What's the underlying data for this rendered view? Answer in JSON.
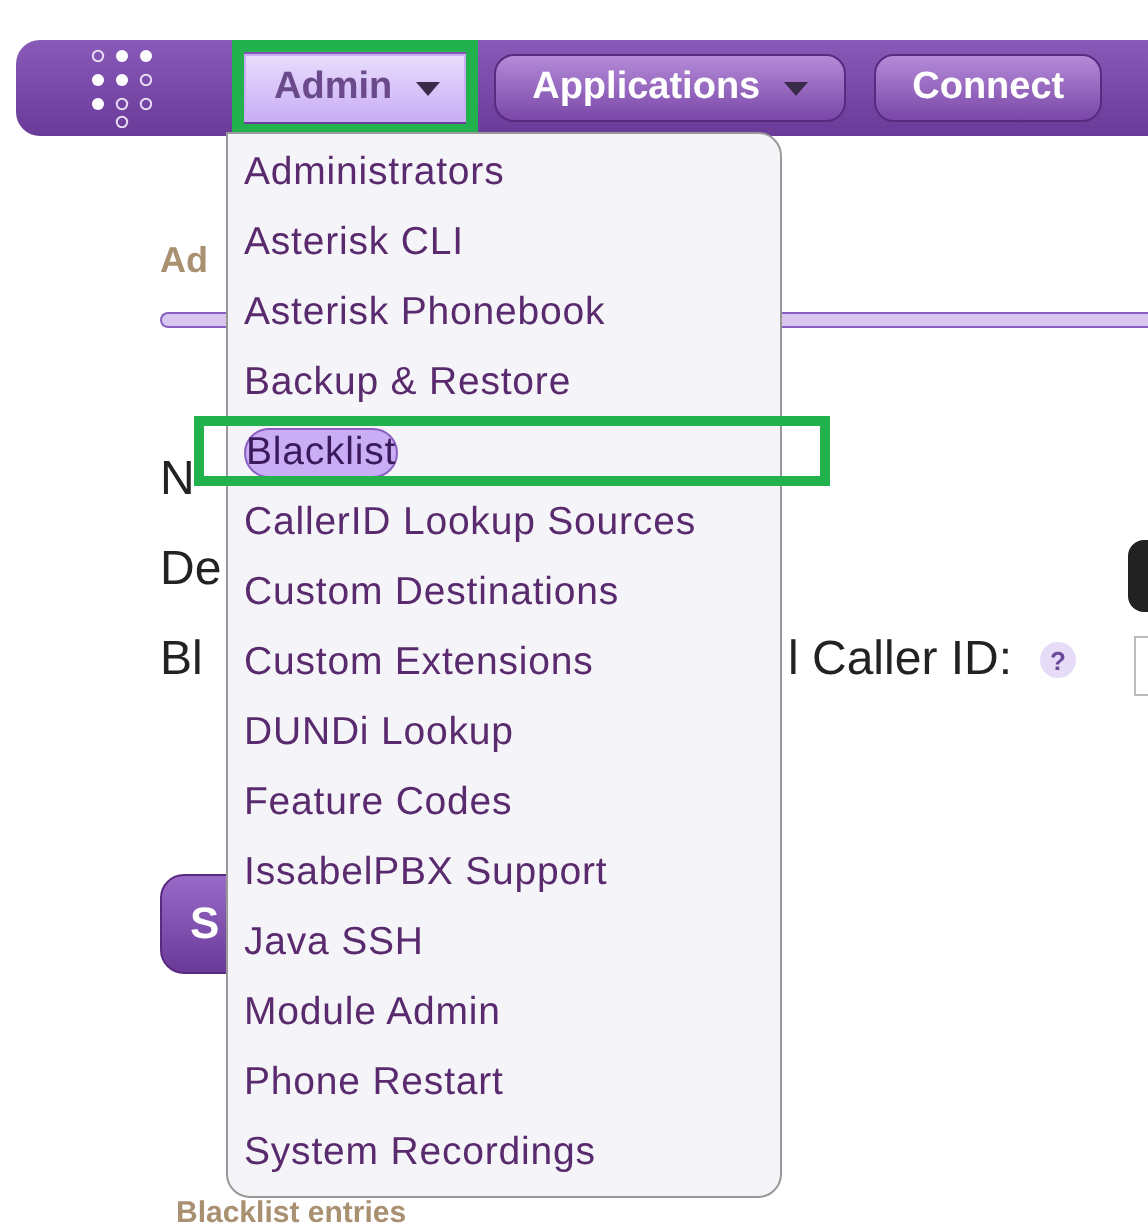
{
  "nav": {
    "tabs": [
      {
        "label": "Admin",
        "caret": true,
        "selected": true,
        "highlighted": true
      },
      {
        "label": "Applications",
        "caret": true,
        "selected": false,
        "highlighted": false
      },
      {
        "label": "Connect",
        "caret": false,
        "selected": false,
        "highlighted": false
      }
    ]
  },
  "menu": {
    "items": [
      {
        "label": "Administrators",
        "selected": false,
        "highlighted": false
      },
      {
        "label": "Asterisk CLI",
        "selected": false,
        "highlighted": false
      },
      {
        "label": "Asterisk Phonebook",
        "selected": false,
        "highlighted": false
      },
      {
        "label": "Backup & Restore",
        "selected": false,
        "highlighted": false
      },
      {
        "label": "Blacklist",
        "selected": true,
        "highlighted": true
      },
      {
        "label": "CallerID Lookup Sources",
        "selected": false,
        "highlighted": false
      },
      {
        "label": "Custom Destinations",
        "selected": false,
        "highlighted": false
      },
      {
        "label": "Custom Extensions",
        "selected": false,
        "highlighted": false
      },
      {
        "label": "DUNDi Lookup",
        "selected": false,
        "highlighted": false
      },
      {
        "label": "Feature Codes",
        "selected": false,
        "highlighted": false
      },
      {
        "label": "IssabelPBX Support",
        "selected": false,
        "highlighted": false
      },
      {
        "label": "Java SSH",
        "selected": false,
        "highlighted": false
      },
      {
        "label": "Module Admin",
        "selected": false,
        "highlighted": false
      },
      {
        "label": "Phone Restart",
        "selected": false,
        "highlighted": false
      },
      {
        "label": "System Recordings",
        "selected": false,
        "highlighted": false
      }
    ]
  },
  "page": {
    "heading": "Ad",
    "fields": [
      {
        "label": "N"
      },
      {
        "label": "De"
      },
      {
        "label": "Bl",
        "label_end": "l Caller ID:",
        "help": "?"
      }
    ],
    "button": "S",
    "section_heading": "Blacklist entries"
  }
}
